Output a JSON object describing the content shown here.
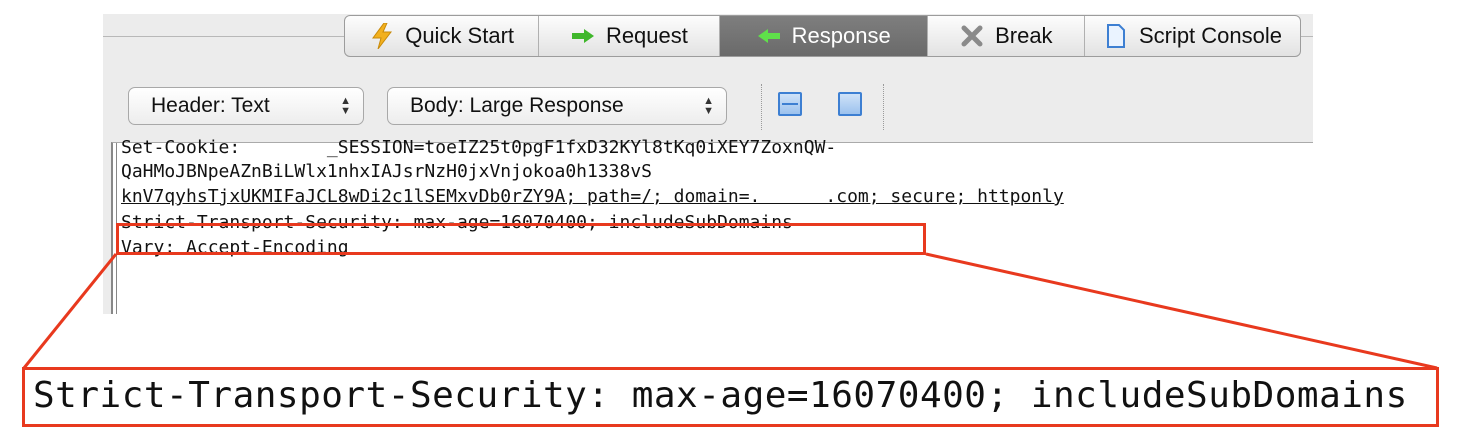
{
  "tabs": [
    {
      "label": "Quick Start",
      "icon": "lightning-icon",
      "active": false
    },
    {
      "label": "Request",
      "icon": "arrow-right-icon",
      "active": false
    },
    {
      "label": "Response",
      "icon": "arrow-left-icon",
      "active": true
    },
    {
      "label": "Break",
      "icon": "x-icon",
      "active": false
    },
    {
      "label": "Script Console",
      "icon": "document-icon",
      "active": false
    }
  ],
  "toolbar": {
    "header_select": "Header: Text",
    "body_select": "Body: Large Response"
  },
  "response_lines": [
    "Set-Cookie:        _SESSION=toeIZ25t0pgF1fxD32KYl8tKq0iXEY7ZoxnQW-",
    "QaHMoJBNpeAZnBiLWlx1nhxIAJsrNzH0jxVnjokoa0h1338vS",
    "knV7qyhsTjxUKMIFaJCL8wDi2c1lSEMxvDb0rZY9A; path=/; domain=.      .com; secure; httponly",
    "Strict-Transport-Security: max-age=16070400; includeSubDomains",
    "Vary: Accept-Encoding"
  ],
  "zoom_text": "Strict-Transport-Security: max-age=16070400; includeSubDomains",
  "colors": {
    "highlight": "#e8391e",
    "active_tab": "#747474",
    "layout_icon": "#3d7fd2"
  }
}
